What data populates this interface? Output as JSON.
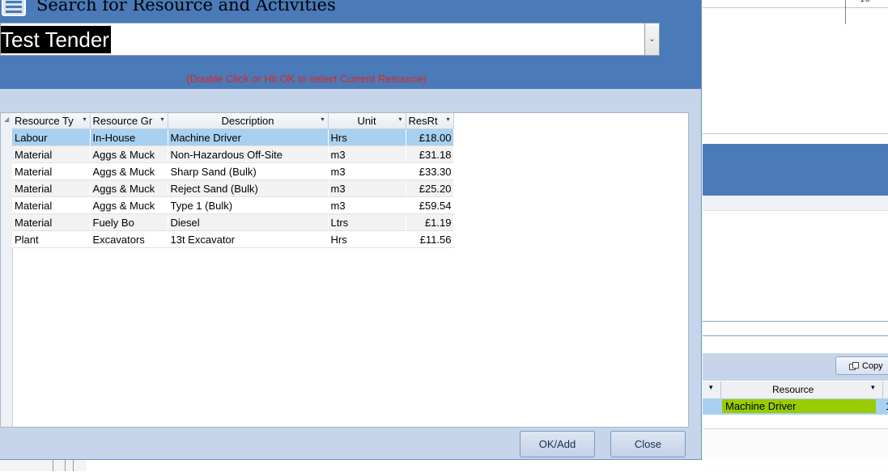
{
  "dialog": {
    "title": "Search for Resource and Activities",
    "combo_value": "Test Tender",
    "hint": "(Double Click or Hit OK to select Current Resource)"
  },
  "table": {
    "headers": [
      "Resource Ty",
      "Resource Gr",
      "Description",
      "Unit",
      "ResRt"
    ],
    "rows": [
      [
        "Labour",
        "In-House",
        "Machine Driver",
        "Hrs",
        "£18.00"
      ],
      [
        "Material",
        "Aggs & Muck",
        "Non-Hazardous Off-Site",
        "m3",
        "£31.18"
      ],
      [
        "Material",
        "Aggs & Muck",
        "Sharp Sand (Bulk)",
        "m3",
        "£33.30"
      ],
      [
        "Material",
        "Aggs & Muck",
        "Reject Sand (Bulk)",
        "m3",
        "£25.20"
      ],
      [
        "Material",
        "Aggs & Muck",
        "Type 1 (Bulk)",
        "m3",
        "£59.54"
      ],
      [
        "Material",
        "Fuely Bo",
        "Diesel",
        "Ltrs",
        "£1.19"
      ],
      [
        "Plant",
        "Excavators",
        "13t Excavator",
        "Hrs",
        "£11.56"
      ]
    ],
    "selected_row": 0
  },
  "buttons": {
    "ok": "OK/Add",
    "close": "Close"
  },
  "background": {
    "top_number": "16",
    "copy_label": "Copy",
    "resource_header": "Resource",
    "resource_value": "Machine Driver",
    "row_count": "1"
  },
  "icons": [
    "form-icon",
    "combo-dropdown-icon",
    "sort-dropdown-icon",
    "copy-icon"
  ],
  "colors": {
    "header_blue": "#4a7ab8",
    "dialog_bg": "#c6d5ea",
    "selected_row": "#a8d0f0",
    "hint_red": "#e0241b",
    "resource_green": "#99cc00"
  }
}
